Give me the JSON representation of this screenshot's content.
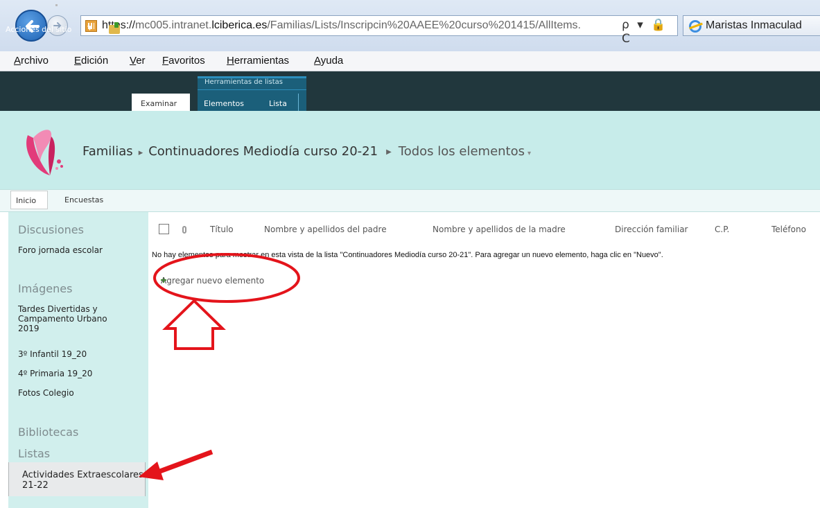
{
  "browser": {
    "url_protocol": "https://",
    "url_domain_pre": "mc005.intranet.",
    "url_domain": "lciberica.es",
    "url_path": "/Familias/Lists/Inscripcin%20AAEE%20curso%201415/AllItems.",
    "url_tools": "ρ ▾ 🔒 C",
    "tab_title": "Maristas Inmaculad"
  },
  "menu": [
    "Archivo",
    "Edición",
    "Ver",
    "Favoritos",
    "Herramientas",
    "Ayuda"
  ],
  "ribbon": {
    "site_actions": "Acciones del sitio",
    "tab_browse": "Examinar",
    "contextual_group": "Herramientas de listas",
    "tab_items": "Elementos",
    "tab_list": "Lista"
  },
  "breadcrumb": {
    "site": "Familias",
    "list": "Continuadores Mediodía curso 20-21",
    "view": "Todos los elementos"
  },
  "topnav": [
    "Inicio",
    "Encuestas"
  ],
  "quicklaunch": {
    "discussions_head": "Discusiones",
    "discussions": [
      "Foro jornada escolar"
    ],
    "images_head": "Imágenes",
    "images": [
      "Tardes Divertidas y Campamento Urbano 2019",
      "3º Infantil 19_20",
      "4º Primaria 19_20",
      "Fotos Colegio"
    ],
    "libraries_head": "Bibliotecas",
    "lists_head": "Listas",
    "lists": [
      "Actividades Extraescolares 21-22"
    ]
  },
  "list_view": {
    "columns": [
      "Título",
      "Nombre y apellidos del padre",
      "Nombre y apellidos de la madre",
      "Dirección familiar",
      "C.P.",
      "Teléfono"
    ],
    "empty_message": "No hay elementos para mostrar en esta vista de la lista \"Continuadores Mediodía curso 20-21\". Para agregar un nuevo elemento, haga clic en \"Nuevo\".",
    "add_new": "Agregar nuevo elemento"
  },
  "colors": {
    "ribbon": "#21373d",
    "title_area": "#c7ecea",
    "quicklaunch": "#d1efed",
    "annotation": "#e4141b"
  }
}
